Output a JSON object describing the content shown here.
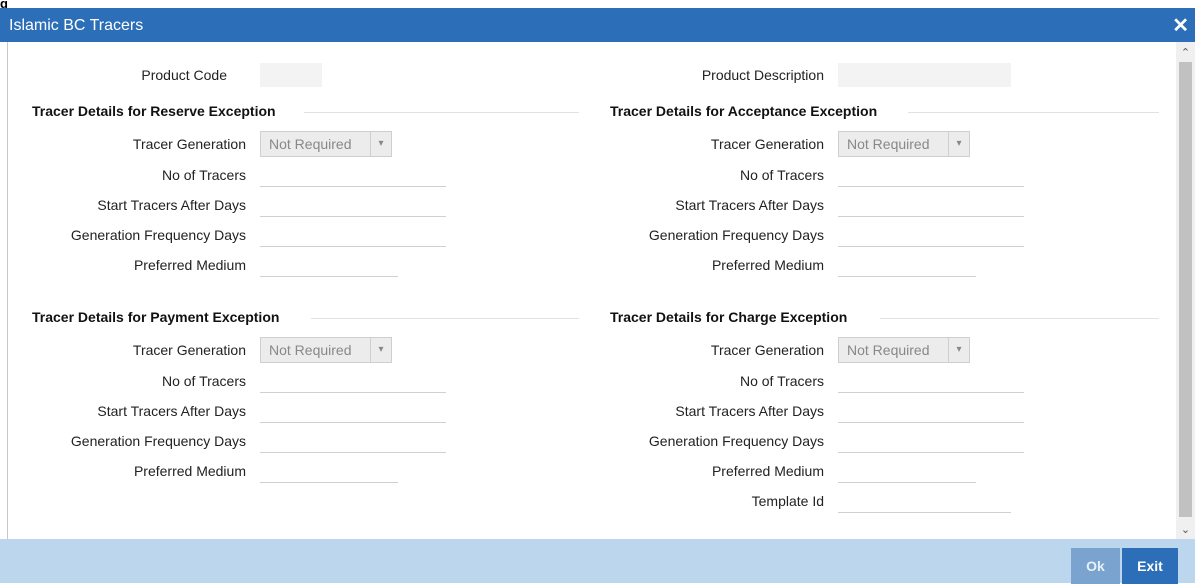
{
  "window": {
    "title": "Islamic BC Tracers",
    "corner": "g"
  },
  "header": {
    "product_code_label": "Product Code",
    "product_description_label": "Product Description"
  },
  "labels": {
    "tracer_generation": "Tracer Generation",
    "no_of_tracers": "No of Tracers",
    "start_tracers_after_days": "Start Tracers After Days",
    "generation_frequency_days": "Generation Frequency Days",
    "preferred_medium": "Preferred Medium",
    "template_id": "Template Id"
  },
  "sections": {
    "reserve": {
      "title": "Tracer Details for Reserve Exception",
      "tracer_generation_value": "Not Required"
    },
    "acceptance": {
      "title": "Tracer Details for Acceptance Exception",
      "tracer_generation_value": "Not Required"
    },
    "payment": {
      "title": "Tracer Details for Payment Exception",
      "tracer_generation_value": "Not Required"
    },
    "charge": {
      "title": "Tracer Details for Charge Exception",
      "tracer_generation_value": "Not Required"
    }
  },
  "footer": {
    "ok_label": "Ok",
    "exit_label": "Exit"
  },
  "colors": {
    "titlebar": "#2c6fb8",
    "footer": "#bcd6ee",
    "button": "#2c6fb8"
  },
  "icons": {
    "close": "close-icon",
    "scroll_up": "chevron-up-icon",
    "scroll_down": "chevron-down-icon",
    "dropdown": "chevron-down-icon"
  }
}
